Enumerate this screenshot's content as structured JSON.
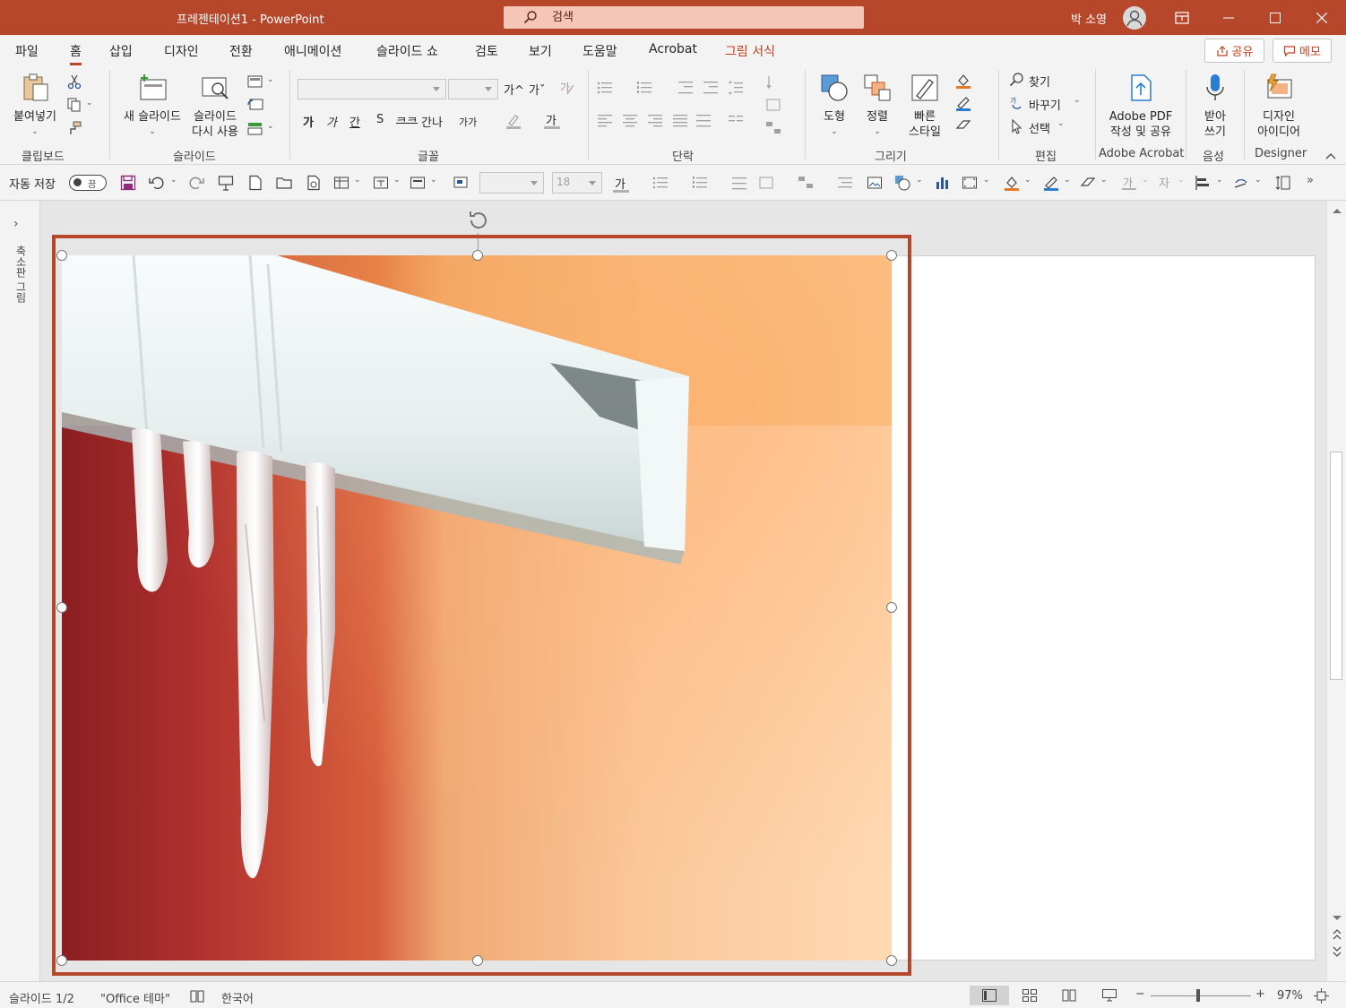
{
  "window": {
    "title": "프레젠테이션1  -  PowerPoint",
    "search_placeholder": "검색",
    "user_name": "박 소영"
  },
  "tabs": [
    {
      "label": "파일"
    },
    {
      "label": "홈",
      "active": true
    },
    {
      "label": "삽입"
    },
    {
      "label": "디자인"
    },
    {
      "label": "전환"
    },
    {
      "label": "애니메이션"
    },
    {
      "label": "슬라이드 쇼"
    },
    {
      "label": "검토"
    },
    {
      "label": "보기"
    },
    {
      "label": "도움말"
    },
    {
      "label": "Acrobat"
    },
    {
      "label": "그림 서식",
      "contextual": true
    }
  ],
  "share": {
    "share_label": "공유",
    "memo_label": "메모"
  },
  "ribbon": {
    "clipboard": {
      "label": "클립보드",
      "paste_label": "붙여넣기"
    },
    "slides": {
      "label": "슬라이드",
      "new_slide_label": "새 슬라이드",
      "reuse_line1": "슬라이드",
      "reuse_line2": "다시 사용"
    },
    "font": {
      "label": "글꼴",
      "grow": "가^",
      "shrink": "가ˇ",
      "b": "가",
      "i": "가",
      "u": "간",
      "s": "S",
      "abc": "ᄏᄏ",
      "spacing": "간나",
      "case": "가가",
      "color_a": "가"
    },
    "paragraph": {
      "label": "단락"
    },
    "drawing": {
      "label": "그리기",
      "shape_label": "도형",
      "arrange_label": "정렬",
      "quickstyle_line1": "빠른",
      "quickstyle_line2": "스타일"
    },
    "editing": {
      "label": "편집",
      "find_label": "찾기",
      "replace_label": "바꾸기",
      "select_label": "선택"
    },
    "acrobat": {
      "label": "Adobe Acrobat",
      "pdf_line1": "Adobe PDF",
      "pdf_line2": "작성 및 공유"
    },
    "voice": {
      "label": "음성",
      "dictate_line1": "받아",
      "dictate_line2": "쓰기"
    },
    "designer": {
      "label": "Designer",
      "ideas_line1": "디자인",
      "ideas_line2": "아이디어"
    }
  },
  "qat": {
    "autosave_label": "자동 저장",
    "autosave_state": "끔",
    "font_size_value": "18",
    "font_color_letter": "가"
  },
  "thumbnail_pane": {
    "vertical_label": "축소판 그림"
  },
  "statusbar": {
    "slide_info": "슬라이드 1/2",
    "theme": "\"Office 테마\"",
    "language": "한국어",
    "zoom_minus": "−",
    "zoom_plus": "+",
    "zoom_level": "97%"
  },
  "colors": {
    "accent": "#b7472a",
    "contextual_tab": "#c43e1c",
    "ribbon_bg": "#f3f3f3"
  }
}
